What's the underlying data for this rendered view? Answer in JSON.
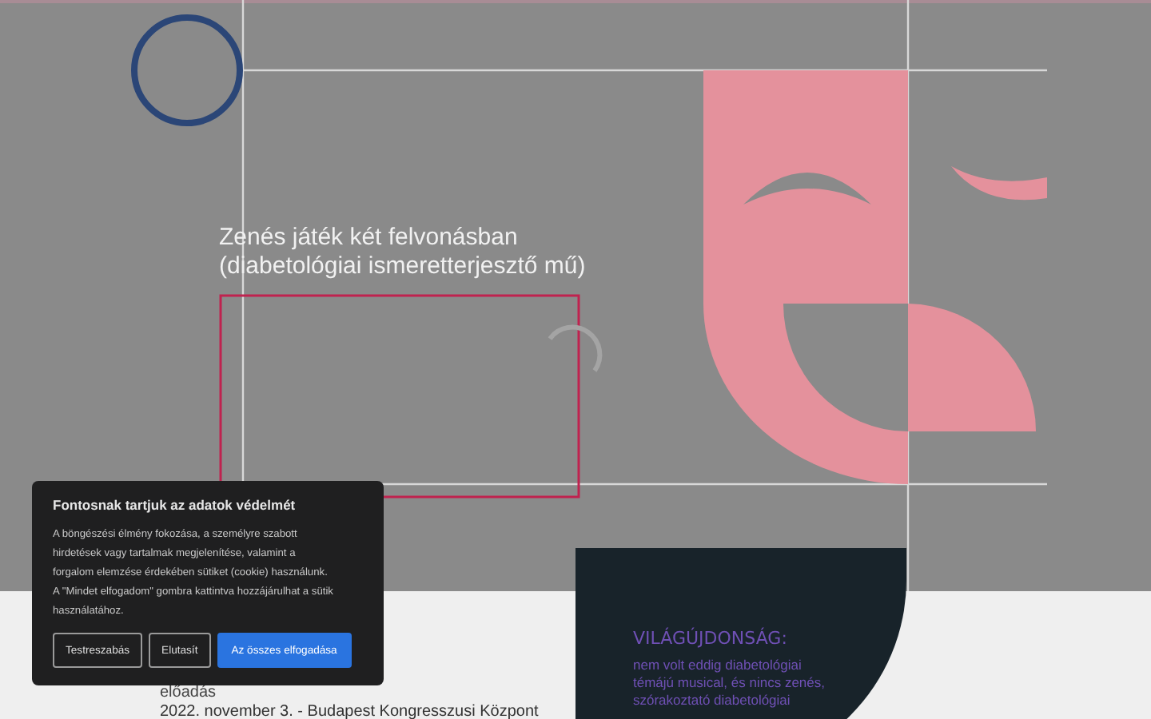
{
  "hero": {
    "subtitle": [
      "Zenés játék két felvonásban",
      "(diabetológiai ismeretterjesztő mű)"
    ]
  },
  "event": {
    "label": "előadás",
    "date": "2022. november 3. - Budapest Kongresszusi Központ"
  },
  "feature": {
    "heading": "VILÁGÚJDONSÁG:",
    "text": "nem volt eddig diabetológiai témájú musical, és nincs zenés, szórakoztató diabetológiai"
  },
  "cookie_dialog": {
    "title": "Fontosnak tartjuk az adatok védelmét",
    "text": "A böngészési élmény fokozása, a személyre szabott hirdetések vagy tartalmak megjelenítése, valamint a forgalom elemzése érdekében sütiket (cookie) használunk. A \"Mindet elfogadom\" gombra kattintva hozzájárulhat a sütik használatához.",
    "buttons": [
      {
        "label": "Testreszabás",
        "kind": "outline"
      },
      {
        "label": "Elutasít",
        "kind": "outline"
      },
      {
        "label": "Az összes elfogadása",
        "kind": "primary"
      }
    ]
  }
}
